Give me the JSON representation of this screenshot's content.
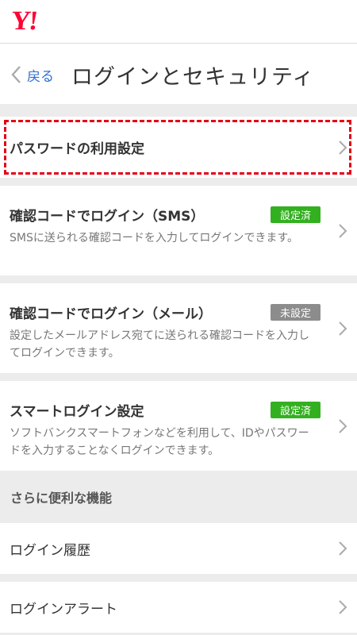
{
  "brand": {
    "logo_text": "Y!",
    "logo_color": "#ff0033"
  },
  "header": {
    "back_label": "戻る",
    "title": "ログインとセキュリティ"
  },
  "items": [
    {
      "title": "パスワードの利用設定",
      "highlighted": true
    },
    {
      "title": "確認コードでログイン（SMS）",
      "badge": "設定済",
      "badge_color": "#33b020",
      "desc": "SMSに送られる確認コードを入力してログインできます。"
    },
    {
      "title": "確認コードでログイン（メール）",
      "badge": "未設定",
      "badge_color": "#8c8c8c",
      "desc": "設定したメールアドレス宛てに送られる確認コードを入力してログインできます。"
    },
    {
      "title": "スマートログイン設定",
      "badge": "設定済",
      "badge_color": "#33b020",
      "desc": "ソフトバンクスマートフォンなどを利用して、IDやパスワードを入力することなくログインできます。"
    }
  ],
  "section": {
    "label": "さらに便利な機能"
  },
  "extras": [
    {
      "title": "ログイン履歴"
    },
    {
      "title": "ログインアラート"
    }
  ],
  "icons": {
    "back": "chevron-left-icon",
    "row_arrow": "chevron-right-icon"
  }
}
